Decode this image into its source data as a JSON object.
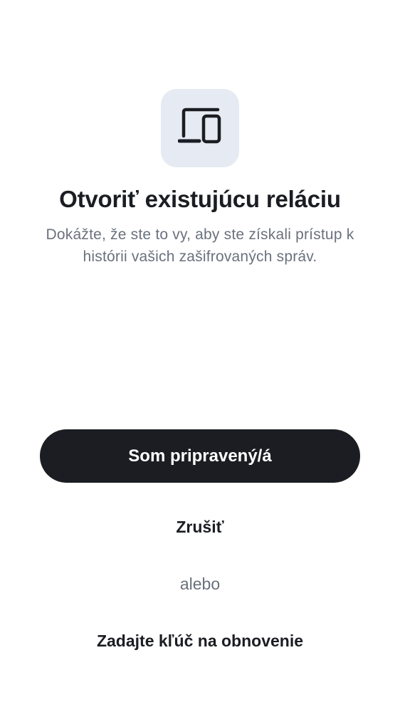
{
  "header": {
    "icon": "devices-icon",
    "title": "Otvoriť existujúcu reláciu",
    "subtitle": "Dokážte, že ste to vy, aby ste získali prístup k histórii vašich zašifrovaných správ."
  },
  "actions": {
    "primary_label": "Som pripravený/á",
    "cancel_label": "Zrušiť",
    "separator_label": "alebo",
    "recovery_label": "Zadajte kľúč na obnovenie"
  },
  "colors": {
    "primary": "#1b1d22",
    "icon_tile": "#e6ebf3",
    "secondary_text": "#6a717d"
  }
}
